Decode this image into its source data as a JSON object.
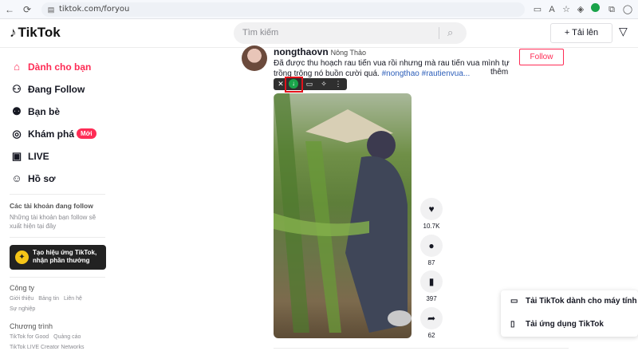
{
  "browser": {
    "url": "tiktok.com/foryou"
  },
  "header": {
    "logo": "TikTok",
    "search_placeholder": "Tìm kiếm",
    "upload_label": "Tải lên"
  },
  "sidebar": {
    "items": [
      {
        "label": "Dành cho bạn",
        "icon": "home-icon"
      },
      {
        "label": "Đang Follow",
        "icon": "following-icon"
      },
      {
        "label": "Bạn bè",
        "icon": "friends-icon"
      },
      {
        "label": "Khám phá",
        "icon": "explore-icon",
        "badge": "Mới"
      },
      {
        "label": "LIVE",
        "icon": "live-icon"
      },
      {
        "label": "Hồ sơ",
        "icon": "profile-icon"
      }
    ],
    "following_heading": "Các tài khoản đang follow",
    "following_note": "Những tài khoản bạn follow sẽ xuất hiện tại đây",
    "effect_button": "Tạo hiệu ứng TikTok, nhận phần thưởng",
    "company_heading": "Công ty",
    "company_links": [
      "Giới thiệu",
      "Bảng tin",
      "Liên hệ"
    ],
    "company_links_2": [
      "Sự nghiệp"
    ],
    "program_heading": "Chương trình",
    "program_links": [
      "TikTok for Good",
      "Quảng cáo"
    ],
    "program_links_2": [
      "TikTok LIVE Creator Networks"
    ]
  },
  "post": {
    "username": "nongthaovn",
    "nickname": "Nông Thảo",
    "caption": "Đã được thu hoạch rau tiến vua rồi nhưng mà rau tiến vua mình tự trồng trông nó buồn cười quá.",
    "hashtags": "#nongthao #rautienvua...",
    "more": "thêm",
    "follow_label": "Follow",
    "likes": "10.7K",
    "comments": "87",
    "saves": "397",
    "shares": "62",
    "accent": "#fe2c55"
  },
  "popup": {
    "desktop_label": "Tải TikTok dành cho máy tính để bàn",
    "app_label": "Tải ứng dụng TikTok"
  }
}
